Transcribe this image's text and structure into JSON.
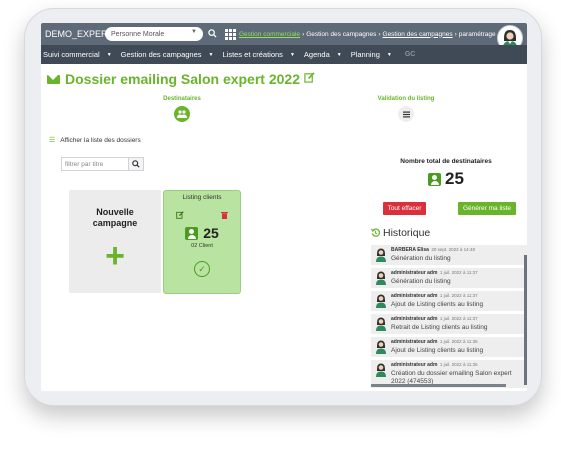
{
  "topbar": {
    "brand": "DEMO_EXPERT",
    "entity_select": "Personne Morale",
    "breadcrumb": [
      {
        "label": "Gestion commerciale",
        "style": "link"
      },
      {
        "label": "Gestion des campagnes",
        "style": "plain"
      },
      {
        "label": "Gestion des campagnes",
        "style": "underline"
      },
      {
        "label": "paramétrage",
        "style": "plain"
      }
    ]
  },
  "navbar": {
    "items": [
      "Suivi commercial",
      "Gestion des campagnes",
      "Listes et créations",
      "Agenda",
      "Planning"
    ],
    "right_label": "GC"
  },
  "page": {
    "title": "Dossier emailing Salon expert 2022"
  },
  "steps": [
    {
      "label": "Destinataires",
      "icon": "users-icon",
      "active": true
    },
    {
      "label": "Validation du listing",
      "icon": "list-icon",
      "active": false
    }
  ],
  "folders": {
    "toggle_label": "Afficher la liste des dossiers",
    "filter_placeholder": "filtrer par titre"
  },
  "cards": {
    "new_campaign_label": "Nouvelle campagne",
    "list_card": {
      "title": "Listing clients",
      "count": "25",
      "subtitle": "02 Client"
    }
  },
  "summary": {
    "total_label": "Nombre total de destinataires",
    "total_value": "25",
    "clear_button": "Tout effacer",
    "generate_button": "Générer ma liste"
  },
  "history": {
    "title": "Historique",
    "items": [
      {
        "user": "BARBERA Elisa",
        "date": "20 sept. 2022 à 14:48",
        "message": "Génération du listing"
      },
      {
        "user": "administrateur adm",
        "date": "1 juil. 2022 à 11:37",
        "message": "Génération du listing"
      },
      {
        "user": "administrateur adm",
        "date": "1 juil. 2022 à 11:37",
        "message": "Ajout de Listing clients au listing"
      },
      {
        "user": "administrateur adm",
        "date": "1 juil. 2022 à 11:37",
        "message": "Retrait de Listing clients au listing"
      },
      {
        "user": "administrateur adm",
        "date": "1 juil. 2022 à 11:36",
        "message": "Ajout de Listing clients au listing"
      },
      {
        "user": "administrateur adm",
        "date": "1 juil. 2022 à 11:36",
        "message": "Création du dossier emailing Salon expert 2022 (474553)"
      }
    ]
  },
  "colors": {
    "accent_green": "#6ab42c",
    "topbar": "#5f6a78",
    "navbar": "#3f4a56",
    "danger": "#d9303c"
  }
}
